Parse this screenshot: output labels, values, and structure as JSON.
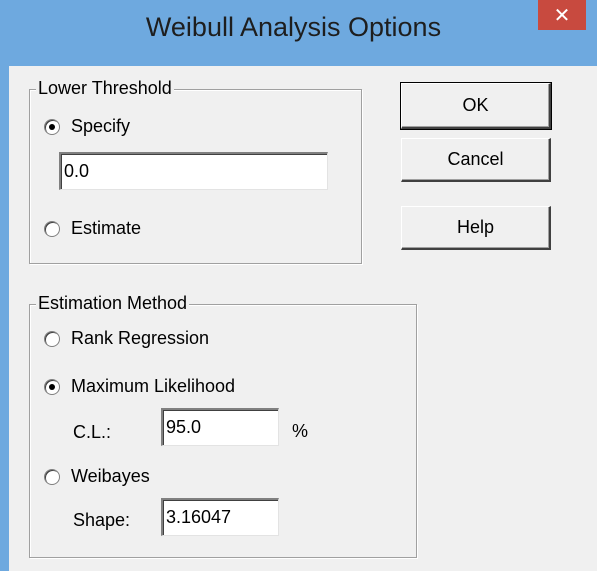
{
  "window": {
    "title": "Weibull Analysis Options",
    "close_glyph": "✕"
  },
  "lower_threshold": {
    "legend": "Lower Threshold",
    "specify_label": "Specify",
    "specify_checked": true,
    "value": "0.0",
    "estimate_label": "Estimate",
    "estimate_checked": false
  },
  "estimation_method": {
    "legend": "Estimation Method",
    "rank_regression_label": "Rank Regression",
    "rank_regression_checked": false,
    "max_likelihood_label": "Maximum Likelihood",
    "max_likelihood_checked": true,
    "cl_label": "C.L.:",
    "cl_value": "95.0",
    "cl_unit": "%",
    "weibayes_label": "Weibayes",
    "weibayes_checked": false,
    "shape_label": "Shape:",
    "shape_value": "3.16047"
  },
  "buttons": {
    "ok_label": "OK",
    "cancel_label": "Cancel",
    "help_label": "Help"
  },
  "colors": {
    "titlebar": "#6ea9df",
    "close_button": "#c84a3f",
    "dialog_face": "#f0f0f0"
  }
}
